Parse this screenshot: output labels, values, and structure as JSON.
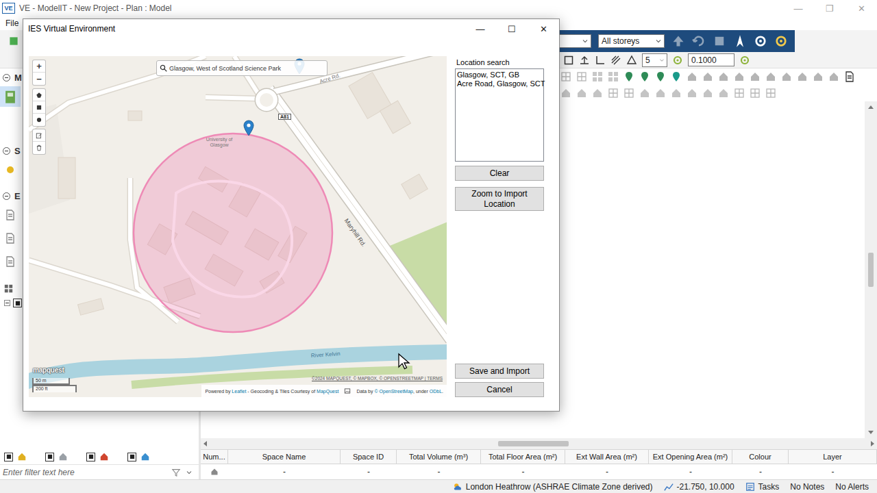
{
  "app": {
    "logo": "VE",
    "title": "VE - ModelIT - New Project - Plan : Model",
    "window_controls": [
      "—",
      "❐",
      "✕"
    ],
    "menu": [
      "File"
    ]
  },
  "toolbar": {
    "storey_select": "All storeys",
    "step_select": "5",
    "grid_value": "0.1000"
  },
  "sidebar": {
    "sections": [
      {
        "label": "M",
        "expanded": true,
        "items": [
          {
            "selected": true
          }
        ]
      },
      {
        "label": "S",
        "expanded": true,
        "items": [
          {
            "selected": false
          }
        ]
      },
      {
        "label": "E",
        "expanded": true,
        "items": [
          {
            "selected": false
          },
          {
            "selected": false
          },
          {
            "selected": false
          }
        ]
      }
    ],
    "tree": {
      "expanded": true,
      "checked": true
    }
  },
  "layer_toggles": [
    {
      "checked": true,
      "color": "#e0b020"
    },
    {
      "checked": true,
      "color": "#9aa0a6"
    },
    {
      "checked": true,
      "color": "#d0452e"
    },
    {
      "checked": true,
      "color": "#3a8fd0"
    }
  ],
  "filter": {
    "placeholder": "Enter filter text here"
  },
  "table": {
    "columns": [
      "Num...",
      "Space Name",
      "Space ID",
      "Total Volume (m³)",
      "Total Floor Area (m²)",
      "Ext Wall Area (m²)",
      "Ext Opening Area (m²)",
      "Colour",
      "Layer"
    ],
    "rows": [
      {
        "cells": [
          "-",
          "-",
          "-",
          "-",
          "-",
          "-",
          "-",
          "-"
        ]
      }
    ]
  },
  "status_bar": [
    {
      "text": "London Heathrow (ASHRAE Climate Zone derived)"
    },
    {
      "text": "-21.750, 10.000"
    },
    {
      "text": "Tasks"
    },
    {
      "text": "No Notes"
    },
    {
      "text": "No Alerts"
    }
  ],
  "dialog": {
    "title": "IES Virtual Environment",
    "controls": [
      "—",
      "☐",
      "✕"
    ],
    "map": {
      "search": "Glasgow, West of Scotland Science Park",
      "zoom": [
        "+",
        "−"
      ],
      "road_labels": [
        {
          "text": "Acre Rd."
        },
        {
          "text": "Maryhill Rd."
        }
      ],
      "road_shield": "A81",
      "place_label": "University of Glasgow",
      "water_label": "River Kelvin",
      "scale": [
        "50 m",
        "200 ft"
      ],
      "logo": "mapquest",
      "attribution": "©2024 MAPQUEST, © MAPBOX, © OPENSTREETMAP | TERMS",
      "credits": [
        [
          {
            "text": "Powered by ",
            "link": false
          },
          {
            "text": "Leaflet",
            "link": true
          },
          {
            "text": " - Geocoding & Tiles Courtesy of ",
            "link": false
          },
          {
            "text": "MapQuest",
            "link": true
          }
        ],
        [
          {
            "text": "Data by ",
            "link": false
          },
          {
            "text": "© OpenStreetMap",
            "link": true
          },
          {
            "text": ", under ",
            "link": false
          },
          {
            "text": "ODbL",
            "link": true
          },
          {
            "text": ".",
            "link": false
          }
        ]
      ]
    },
    "location_search": {
      "label": "Location search",
      "results": [
        {
          "text": "Glasgow, SCT, GB",
          "selected": false
        },
        {
          "text": "Acre Road, Glasgow, SCT",
          "selected": false
        }
      ]
    },
    "buttons": {
      "clear": "Clear",
      "zoom": "Zoom to Import Location",
      "save": "Save and Import",
      "cancel": "Cancel"
    }
  }
}
